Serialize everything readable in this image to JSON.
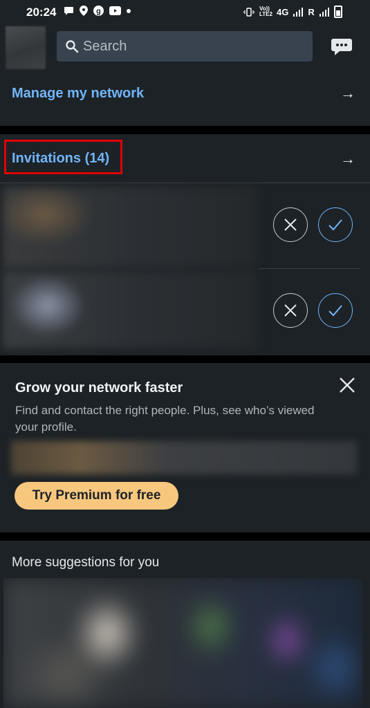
{
  "status_bar": {
    "time": "20:24",
    "left_icons": [
      "chat-bubble-icon",
      "location-icon",
      "g-icon",
      "youtube-icon",
      "dot-icon"
    ],
    "network_label": "4G",
    "roaming_label": "R",
    "volte_label": "Vo)) LTE2"
  },
  "header": {
    "search_placeholder": "Search"
  },
  "network": {
    "manage_label": "Manage my network",
    "arrow": "→"
  },
  "invitations": {
    "title": "Invitations (14)",
    "arrow": "→",
    "items": [
      {
        "ignore_label": "✕",
        "accept_label": "✓"
      },
      {
        "ignore_label": "✕",
        "accept_label": "✓"
      }
    ]
  },
  "premium": {
    "title": "Grow your network faster",
    "body": "Find and contact the right people. Plus, see who’s viewed your profile.",
    "cta": "Try Premium for free",
    "accent_color": "#f8c77e"
  },
  "suggestions": {
    "title": "More suggestions for you"
  },
  "colors": {
    "background": "#000000",
    "card": "#1d2226",
    "link": "#70b5f9",
    "highlight_box": "#e10000"
  }
}
